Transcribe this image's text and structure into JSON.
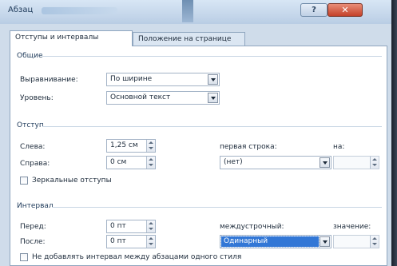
{
  "window": {
    "title": "Абзац",
    "help_label": "?",
    "close_label": "✕"
  },
  "tabs": [
    {
      "label": "Отступы и интервалы"
    },
    {
      "label": "Положение на странице"
    }
  ],
  "general": {
    "label": "Общие",
    "alignment_label": "Выравнивание:",
    "alignment_value": "По ширине",
    "level_label": "Уровень:",
    "level_value": "Основной текст"
  },
  "indent": {
    "label": "Отступ",
    "left_label": "Слева:",
    "left_value": "1,25 см",
    "right_label": "Справа:",
    "right_value": "0 см",
    "first_line_label": "первая строка:",
    "first_line_value": "(нет)",
    "by_label": "на:",
    "by_value": "",
    "mirror_label": "Зеркальные отступы"
  },
  "spacing": {
    "label": "Интервал",
    "before_label": "Перед:",
    "before_value": "0 пт",
    "after_label": "После:",
    "after_value": "0 пт",
    "line_spacing_label": "междустрочный:",
    "line_spacing_value": "Одинарный",
    "value_label": "значение:",
    "value_value": "",
    "no_space_label": "Не добавлять интервал между абзацами одного стиля"
  },
  "colors": {
    "accent": "#3277d6",
    "titlebar": "#c7d9ec",
    "close": "#c4412a"
  },
  "icons": [
    "help-icon",
    "close-icon",
    "dropdown-arrow-icon",
    "spinner-icon",
    "checkbox-icon"
  ]
}
